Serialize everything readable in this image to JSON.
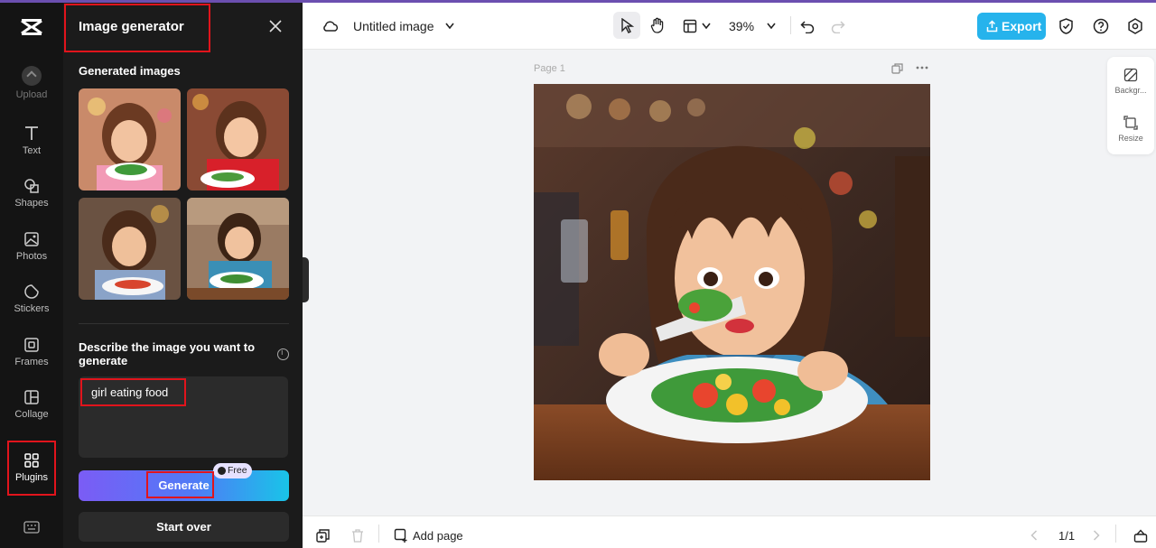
{
  "rail": {
    "items": [
      {
        "label": "Upload",
        "icon": "upload-icon"
      },
      {
        "label": "Text",
        "icon": "text-icon"
      },
      {
        "label": "Shapes",
        "icon": "shapes-icon"
      },
      {
        "label": "Photos",
        "icon": "photos-icon"
      },
      {
        "label": "Stickers",
        "icon": "stickers-icon"
      },
      {
        "label": "Frames",
        "icon": "frames-icon"
      },
      {
        "label": "Collage",
        "icon": "collage-icon"
      },
      {
        "label": "Plugins",
        "icon": "plugins-icon"
      }
    ]
  },
  "panel": {
    "title": "Image generator",
    "generated_title": "Generated images",
    "describe_label": "Describe the image you want to generate",
    "prompt_value": "girl eating food",
    "generate_label": "Generate",
    "free_badge": "Free",
    "start_over_label": "Start over"
  },
  "topbar": {
    "doc_title": "Untitled image",
    "zoom": "39%",
    "export_label": "Export"
  },
  "canvas": {
    "page_label": "Page 1"
  },
  "side_tools": {
    "background_label": "Backgr...",
    "resize_label": "Resize"
  },
  "bottombar": {
    "add_page_label": "Add page",
    "pager": "1/1"
  },
  "colors": {
    "accent": "#26b3ec",
    "highlight_box": "#e1141c",
    "panel_bg": "#1b1b1b",
    "rail_bg": "#141414"
  }
}
